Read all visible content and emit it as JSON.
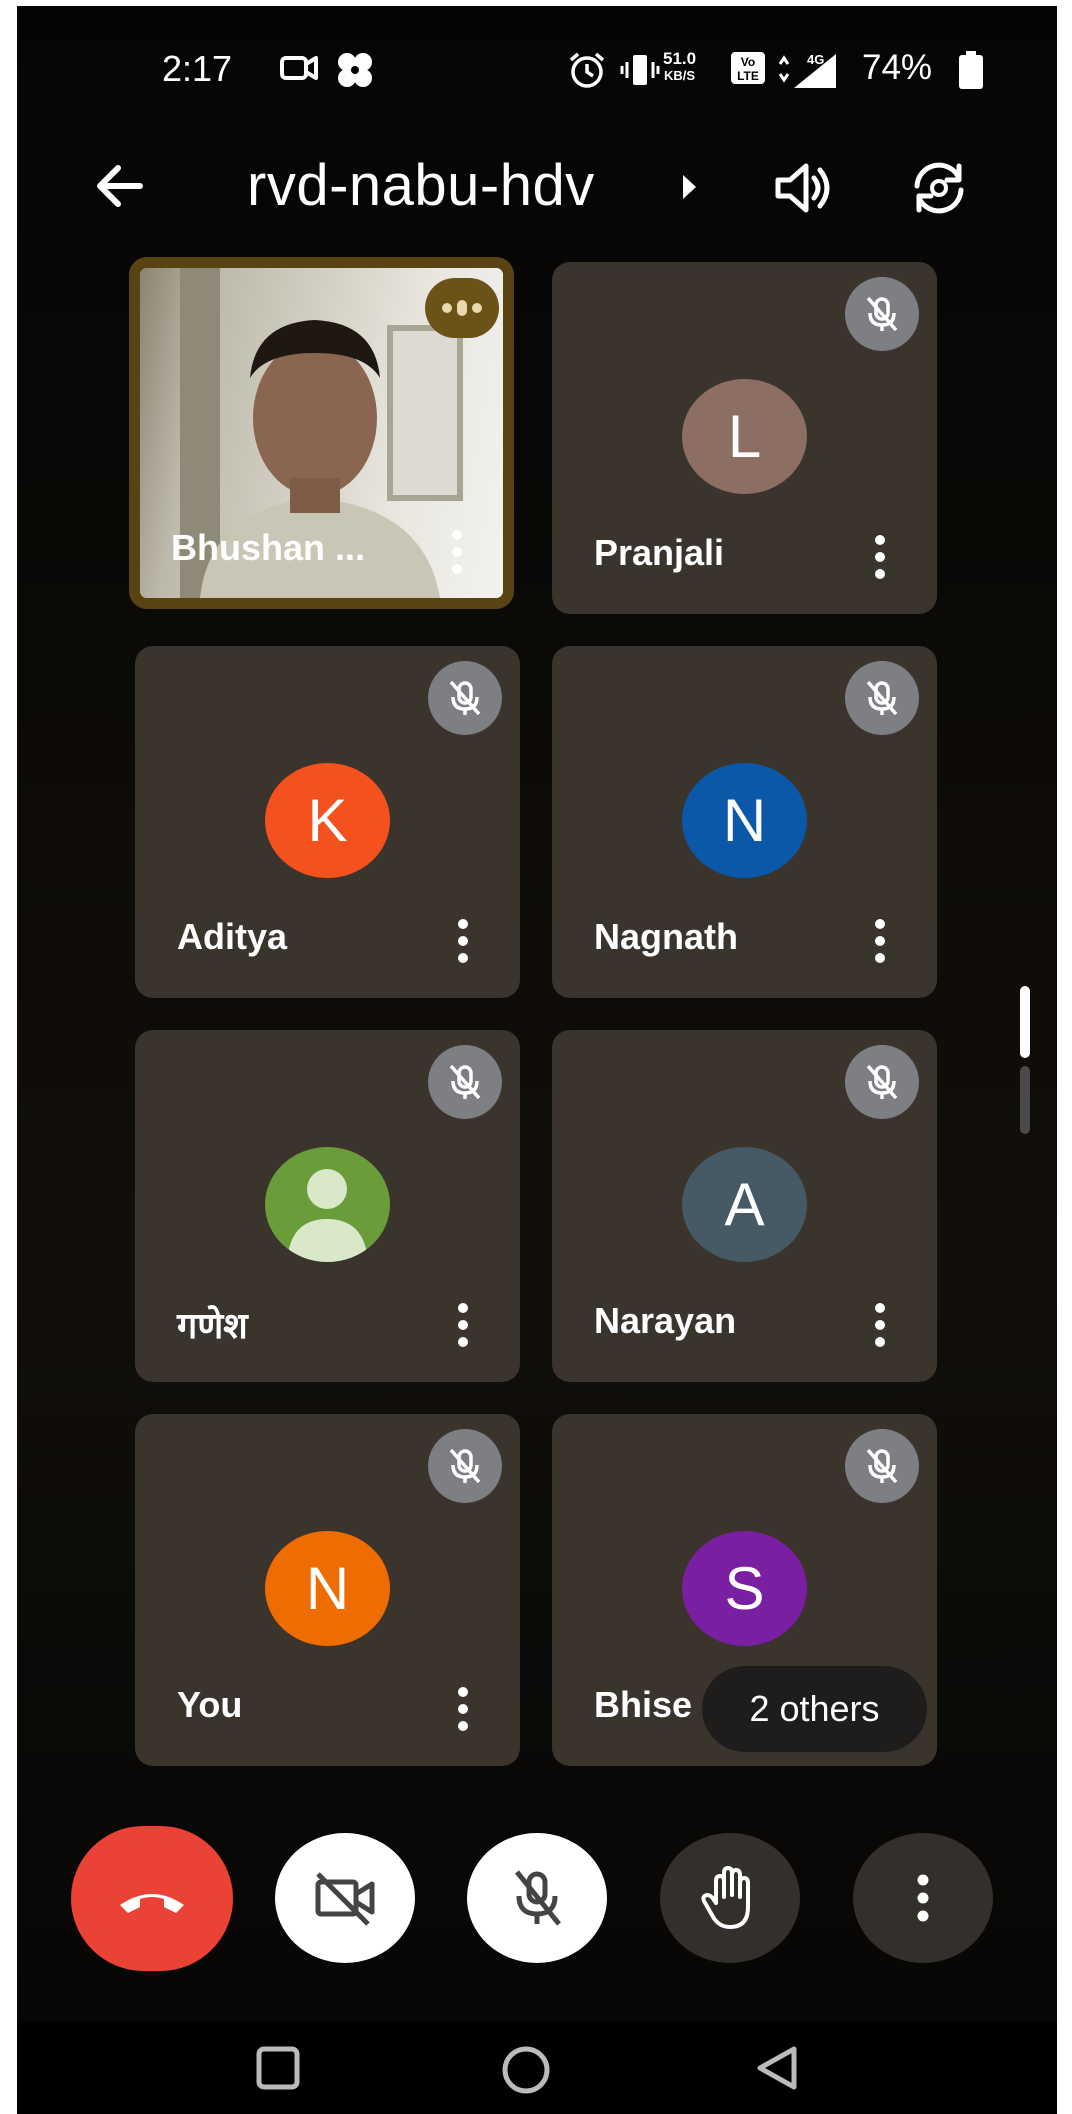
{
  "status_bar": {
    "time": "2:17",
    "data_rate_value": "51.0",
    "data_rate_unit": "KB/S",
    "volte": "Vo LTE",
    "network": "4G",
    "battery": "74%"
  },
  "header": {
    "meeting_code": "rvd-nabu-hdv",
    "icons": [
      "back-arrow-icon",
      "caret-right-icon",
      "speaker-icon",
      "switch-camera-icon"
    ]
  },
  "participants": [
    {
      "name": "Bhushan ...",
      "initial": "",
      "color": "",
      "muted": false,
      "speaking": true,
      "video": true
    },
    {
      "name": "Pranjali",
      "initial": "L",
      "color": "#8d6e63",
      "muted": true
    },
    {
      "name": "Aditya",
      "initial": "K",
      "color": "#f4511e",
      "muted": true
    },
    {
      "name": "Nagnath",
      "initial": "N",
      "color": "#0b57a8",
      "muted": true
    },
    {
      "name": "गणेश",
      "initial": "",
      "color": "#6a9c3a",
      "muted": true,
      "generic_avatar": true
    },
    {
      "name": "Narayan",
      "initial": "A",
      "color": "#455a64",
      "muted": true
    },
    {
      "name": "You",
      "initial": "N",
      "color": "#ef6c00",
      "muted": true
    },
    {
      "name": "Bhise",
      "initial": "S",
      "color": "#7b1fa2",
      "muted": true
    }
  ],
  "others_chip": "2 others",
  "controls": {
    "end_call": "end-call-icon",
    "camera": "camera-off-icon",
    "mic": "mic-off-icon",
    "hand": "raise-hand-icon",
    "more": "more-options-icon"
  },
  "colors": {
    "end_call": "#ea4335",
    "tile_bg": "#3a342c",
    "mute_badge": "#7d7f84",
    "active_border": "#5a4312"
  }
}
